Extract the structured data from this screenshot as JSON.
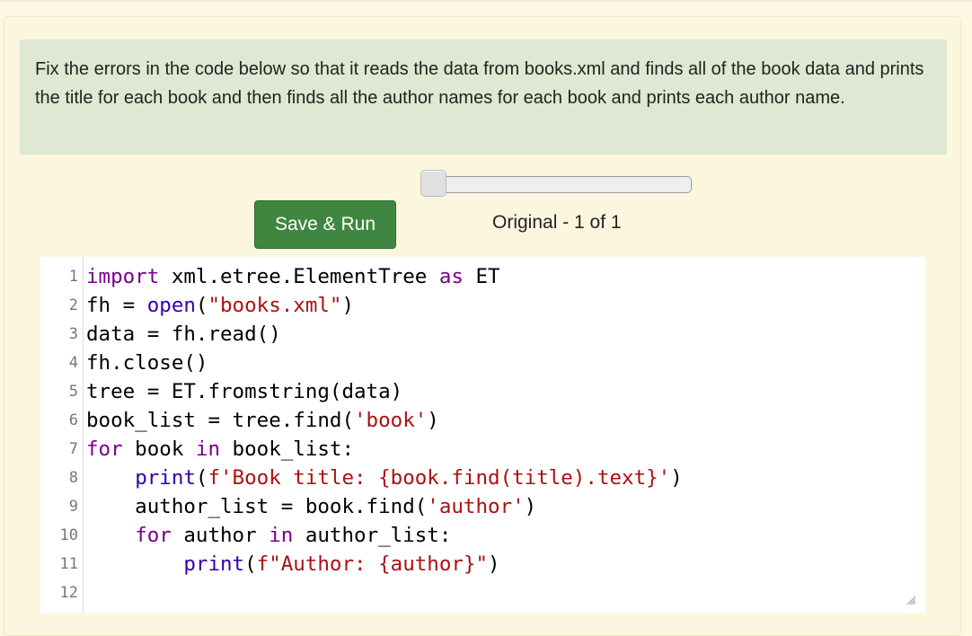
{
  "instructions": "Fix the errors in the code below so that it reads the data from books.xml and finds all of the book data and prints the title for each book and then finds all the author names for each book and prints each author name.",
  "run_button_label": "Save & Run",
  "version_label": "Original - 1 of 1",
  "version_slider": {
    "current": 1,
    "total": 1
  },
  "editor": {
    "line_numbers": [
      "1",
      "2",
      "3",
      "4",
      "5",
      "6",
      "7",
      "8",
      "9",
      "10",
      "11",
      "12"
    ],
    "lines": [
      [
        {
          "t": "import",
          "c": "kw"
        },
        {
          "t": " xml.etree.ElementTree "
        },
        {
          "t": "as",
          "c": "kw"
        },
        {
          "t": " ET"
        }
      ],
      [
        {
          "t": "fh = "
        },
        {
          "t": "open",
          "c": "bi"
        },
        {
          "t": "("
        },
        {
          "t": "\"books.xml\"",
          "c": "str"
        },
        {
          "t": ")"
        }
      ],
      [
        {
          "t": "data = fh.read()"
        }
      ],
      [
        {
          "t": "fh.close()"
        }
      ],
      [
        {
          "t": "tree = ET.fromstring(data)"
        }
      ],
      [
        {
          "t": "book_list = tree.find("
        },
        {
          "t": "'book'",
          "c": "str"
        },
        {
          "t": ")"
        }
      ],
      [
        {
          "t": "for",
          "c": "kw"
        },
        {
          "t": " book "
        },
        {
          "t": "in",
          "c": "kw"
        },
        {
          "t": " book_list:"
        }
      ],
      [
        {
          "t": "    "
        },
        {
          "t": "print",
          "c": "bi"
        },
        {
          "t": "("
        },
        {
          "t": "f'Book title: {book.find(title).text}'",
          "c": "str"
        },
        {
          "t": ")"
        }
      ],
      [
        {
          "t": "    author_list = book.find("
        },
        {
          "t": "'author'",
          "c": "str"
        },
        {
          "t": ")"
        }
      ],
      [
        {
          "t": "    "
        },
        {
          "t": "for",
          "c": "kw"
        },
        {
          "t": " author "
        },
        {
          "t": "in",
          "c": "kw"
        },
        {
          "t": " author_list:"
        }
      ],
      [
        {
          "t": "        "
        },
        {
          "t": "print",
          "c": "bi"
        },
        {
          "t": "("
        },
        {
          "t": "f\"Author: {author}\"",
          "c": "str"
        },
        {
          "t": ")"
        }
      ],
      []
    ]
  },
  "colors": {
    "keyword": "#770088",
    "builtin": "#3300aa",
    "string": "#aa1111",
    "run_button": "#3f8741",
    "instructions_bg": "#dfe8d2",
    "page_bg": "#fcf6df"
  },
  "icons": {
    "resize": "resize-grip-icon"
  }
}
